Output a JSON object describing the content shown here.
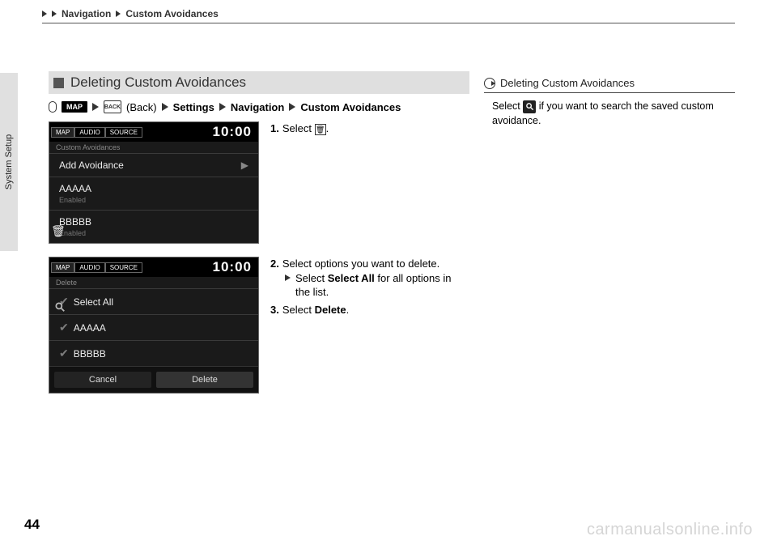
{
  "header": {
    "crumb1": "Navigation",
    "crumb2": "Custom Avoidances"
  },
  "sidetab": "System Setup",
  "section_title": "Deleting Custom Avoidances",
  "path": {
    "map": "MAP",
    "back": "(Back)",
    "back_icon": "BACK",
    "settings": "Settings",
    "navigation": "Navigation",
    "custom": "Custom Avoidances"
  },
  "shot1": {
    "tabs": [
      "MAP",
      "AUDIO",
      "SOURCE"
    ],
    "clock": "10:00",
    "subtitle": "Custom Avoidances",
    "row_add": "Add Avoidance",
    "row_a": "AAAAA",
    "row_a_sub": "Enabled",
    "row_b": "BBBBB",
    "row_b_sub": "Enabled"
  },
  "shot2": {
    "tabs": [
      "MAP",
      "AUDIO",
      "SOURCE"
    ],
    "clock": "10:00",
    "subtitle": "Delete",
    "row_all": "Select All",
    "row_a": "AAAAA",
    "row_b": "BBBBB",
    "btn_cancel": "Cancel",
    "btn_delete": "Delete"
  },
  "steps": {
    "s1_pre": "Select ",
    "s1_post": ".",
    "s2": "Select options you want to delete.",
    "s2_sub_pre": "Select ",
    "s2_sub_bold": "Select All",
    "s2_sub_post": " for all options in the list.",
    "s3_pre": "Select ",
    "s3_bold": "Delete",
    "s3_post": "."
  },
  "note": {
    "title": "Deleting Custom Avoidances",
    "body_pre": "Select ",
    "body_post": " if you want to search the saved custom avoidance."
  },
  "page_number": "44",
  "watermark": "carmanualsonline.info"
}
